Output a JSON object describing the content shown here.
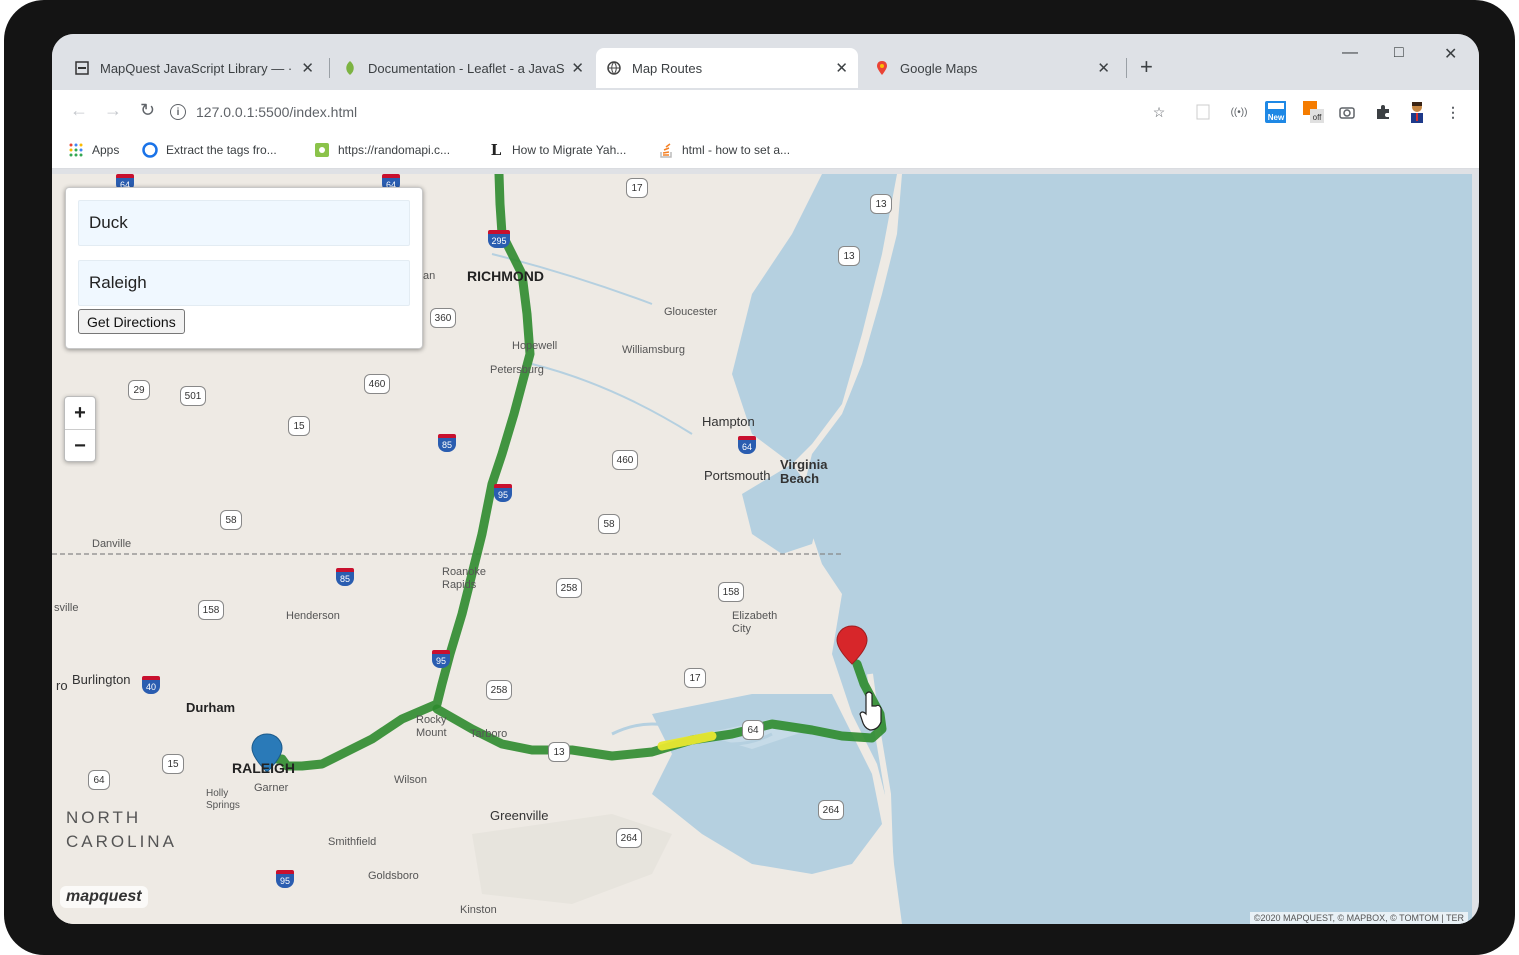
{
  "browser": {
    "tabs": [
      {
        "title": "MapQuest JavaScript Library — ·",
        "icon": "mapquest-icon"
      },
      {
        "title": "Documentation - Leaflet - a JavaS",
        "icon": "leaflet-icon"
      },
      {
        "title": "Map Routes",
        "icon": "globe-icon",
        "active": true
      },
      {
        "title": "Google Maps",
        "icon": "google-maps-icon"
      }
    ],
    "new_tab": "+",
    "window_controls": {
      "minimize": "—",
      "maximize": "□",
      "close": "✕"
    },
    "url": "127.0.0.1:5500/index.html",
    "bookmarks": [
      {
        "label": "Apps",
        "icon": "apps-grid-icon"
      },
      {
        "label": "Extract the tags fro...",
        "icon": "circle-icon"
      },
      {
        "label": "https://randomapi.c...",
        "icon": "randomapi-icon"
      },
      {
        "label": "How to Migrate Yah...",
        "icon": "l-icon"
      },
      {
        "label": "html - how to set a...",
        "icon": "stackoverflow-icon"
      }
    ],
    "extension_labels": {
      "new": "New",
      "off": "off"
    }
  },
  "directions_panel": {
    "start_value": "Duck",
    "end_value": "Raleigh",
    "button_label": "Get Directions"
  },
  "zoom": {
    "in": "+",
    "out": "−"
  },
  "map": {
    "logo": "mapquest",
    "attribution": "©2020 MAPQUEST, © MAPBOX, © TOMTOM | TER",
    "colors": {
      "route": "#2e8b2e",
      "route_congestion": "#e8e830",
      "water": "#b5d0e0",
      "land": "#eeeae4",
      "start_marker": "#2a7ab8",
      "end_marker": "#d7262a"
    },
    "labels": {
      "richmond": "RICHMOND",
      "gloucester": "Gloucester",
      "williamsburg": "Williamsburg",
      "hopewell": "Hopewell",
      "petersburg": "Petersburg",
      "hampton": "Hampton",
      "portsmouth": "Portsmouth",
      "virginia_beach": "Virginia\nBeach",
      "danville": "Danville",
      "roanoke_rapids": "Roanoke\nRapids",
      "henderson": "Henderson",
      "elizabeth_city": "Elizabeth\nCity",
      "burlington": "Burlington",
      "durham": "Durham",
      "raleigh": "RALEIGH",
      "garner": "Garner",
      "holly_springs": "Holly\nSprings",
      "rocky_mount": "Rocky\nMount",
      "tarboro": "Tarboro",
      "wilson": "Wilson",
      "greenville": "Greenville",
      "smithfield": "Smithfield",
      "goldsboro": "Goldsboro",
      "kinston": "Kinston",
      "north_carolina": "NORTH\nCAROLINA",
      "ro": "ro",
      "sville": "sville",
      "tan": "tan"
    },
    "shields": [
      "17",
      "13",
      "13",
      "360",
      "460",
      "29",
      "501",
      "15",
      "460",
      "58",
      "58",
      "258",
      "158",
      "158",
      "17",
      "258",
      "264",
      "264",
      "15",
      "64",
      "64",
      "13"
    ],
    "interstates": [
      "64",
      "295",
      "85",
      "64",
      "95",
      "85",
      "95",
      "40",
      "95",
      "64"
    ]
  }
}
